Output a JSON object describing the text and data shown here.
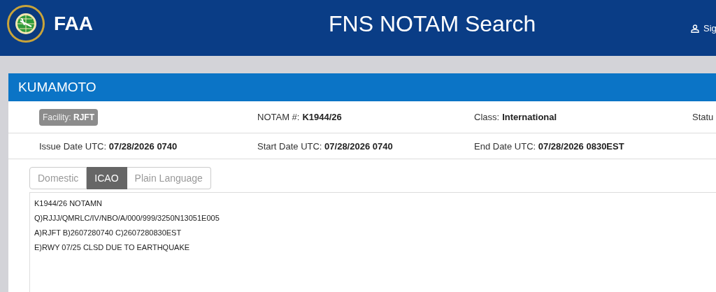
{
  "header": {
    "logo_text": "FAA",
    "title": "FNS NOTAM Search",
    "user_link": "Sig"
  },
  "panel": {
    "title": "KUMAMOTO"
  },
  "facility": {
    "label": "Facility:",
    "value": "RJFT"
  },
  "fields_row_1": [
    {
      "label": "NOTAM #:",
      "value": "K1944/26"
    },
    {
      "label": "Class:",
      "value": "International"
    },
    {
      "label": "Statu"
    }
  ],
  "fields_row_2": [
    {
      "label": "Issue Date UTC:",
      "value": "07/28/2026 0740"
    },
    {
      "label": "Start Date UTC:",
      "value": "07/28/2026 0740"
    },
    {
      "label": "End Date UTC:",
      "value": "07/28/2026 0830EST"
    }
  ],
  "tabs": [
    {
      "label": "Domestic",
      "selected": false
    },
    {
      "label": "ICAO",
      "selected": true
    },
    {
      "label": "Plain Language",
      "selected": false
    }
  ],
  "notam_lines": [
    "K1944/26 NOTAMN",
    "Q)RJJJ/QMRLC/IV/NBO/A/000/999/3250N13051E005",
    "A)RJFT B)2607280740 C)2607280830EST",
    "E)RWY 07/25 CLSD DUE TO EARTHQUAKE"
  ]
}
